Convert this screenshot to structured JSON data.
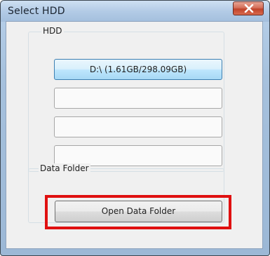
{
  "window": {
    "title": "Select HDD"
  },
  "hdd_group": {
    "label": "HDD",
    "drives": [
      {
        "label": "D:\\ (1.61GB/298.09GB)",
        "selected": true
      },
      {
        "label": "",
        "selected": false
      },
      {
        "label": "",
        "selected": false
      },
      {
        "label": "",
        "selected": false
      }
    ]
  },
  "data_folder_group": {
    "label": "Data Folder",
    "open_button_label": "Open Data Folder"
  },
  "colors": {
    "highlight": "#e01010",
    "selected_drive_border": "#3c7fb1"
  }
}
